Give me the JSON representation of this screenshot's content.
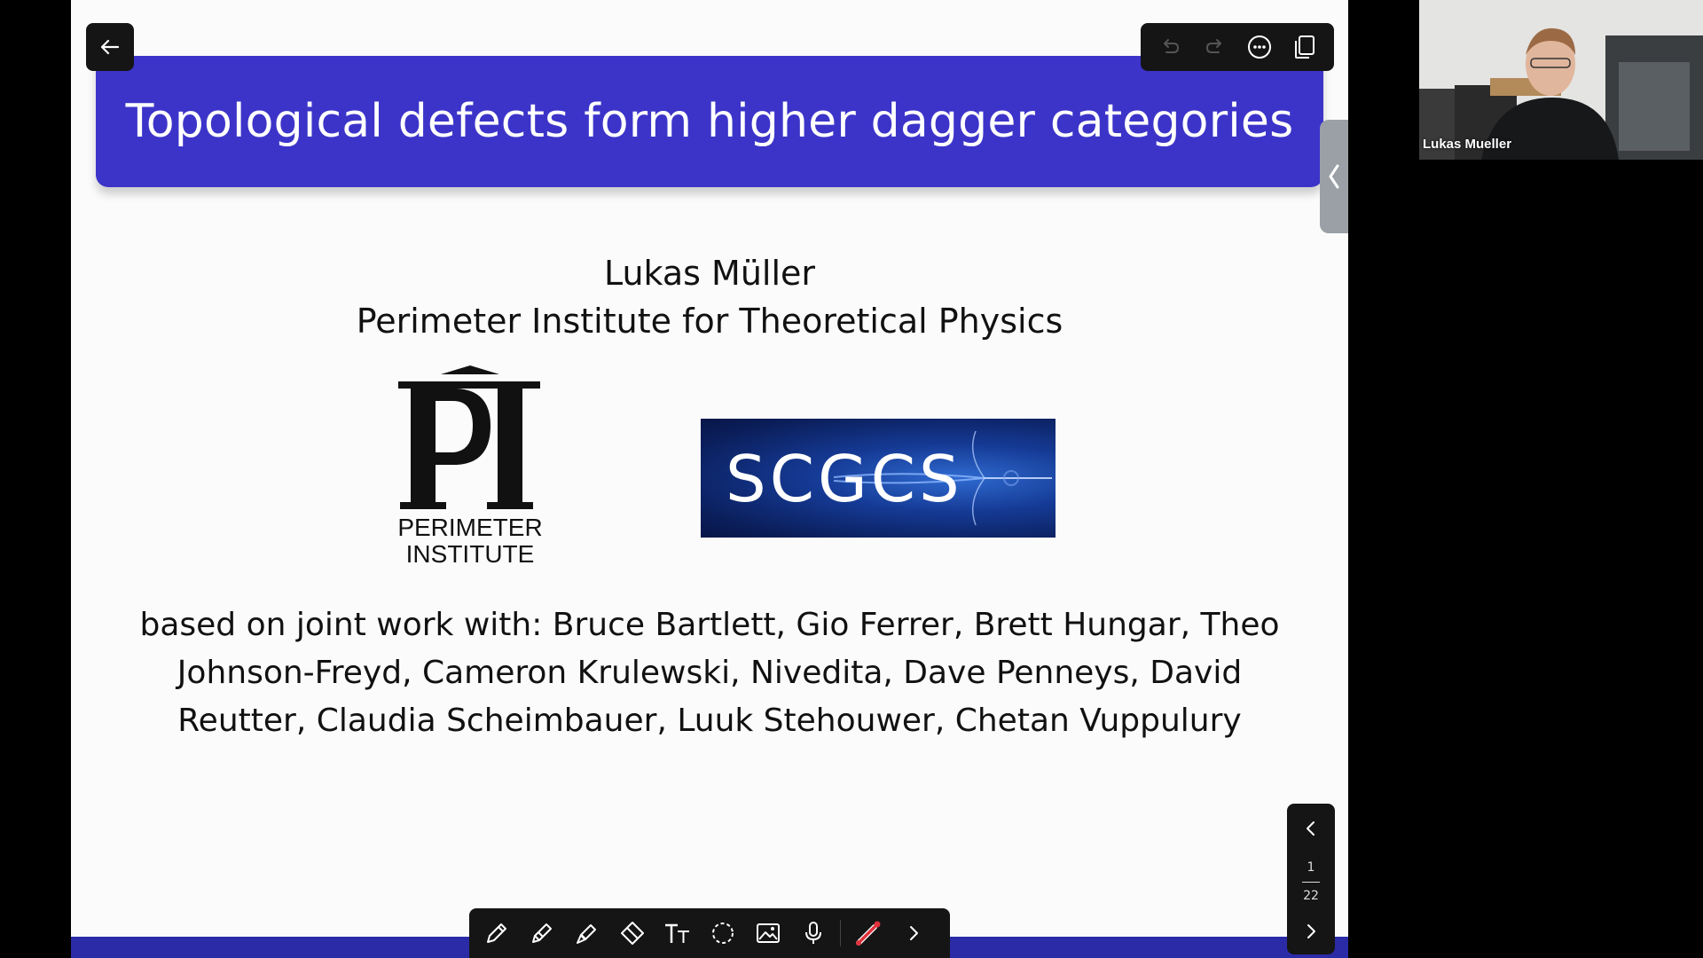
{
  "slide": {
    "title": "Topological defects form higher dagger categories",
    "author": "Lukas Müller",
    "affiliation": "Perimeter Institute for Theoretical Physics",
    "pi_logo": {
      "caption_line1": "PERIMETER",
      "caption_line2": "INSTITUTE"
    },
    "sqgcs_logo": {
      "text": "SCGCS"
    },
    "joint_work": "based on joint work with: Bruce Bartlett, Gio Ferrer, Brett Hungar, Theo Johnson-Freyd, Cameron Krulewski, Nivedita, Dave Penneys, David Reutter, Claudia Scheimbauer, Luuk Stehouwer, Chetan Vuppulury"
  },
  "pager": {
    "current": "1",
    "total": "22"
  },
  "video": {
    "participant_name": "Lukas Mueller"
  },
  "top_toolbar": {
    "icons": [
      "undo-icon",
      "redo-icon",
      "more-icon",
      "copy-pages-icon"
    ]
  },
  "bottom_toolbar": {
    "icons": [
      "pen-icon",
      "pencil-icon",
      "marker-icon",
      "eraser-icon",
      "text-icon",
      "lasso-icon",
      "image-icon",
      "microphone-icon",
      "laser-pointer-icon",
      "chevron-right-icon"
    ]
  },
  "colors": {
    "title_bar": "#3c34c9",
    "toolbar_bg": "#151515",
    "laser_red": "#e0323c"
  }
}
